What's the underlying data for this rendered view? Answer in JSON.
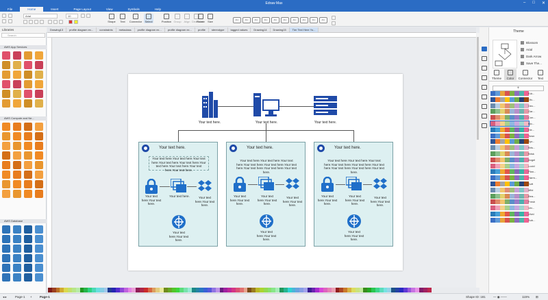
{
  "window": {
    "title": "Edraw Max"
  },
  "menu": [
    "File",
    "Home",
    "Insert",
    "Page Layout",
    "View",
    "Symbols",
    "Help"
  ],
  "ribbon": {
    "font": "Arial",
    "size": "10",
    "tools": [
      "Shape",
      "Text",
      "Connector",
      "Select",
      "Position",
      "Group",
      "Align",
      "Distribute",
      "Rotate",
      "Size"
    ],
    "style_label": "Abc"
  },
  "libraries": {
    "title": "Libraries",
    "search_placeholder": "Search",
    "sections": [
      "AWS App Services",
      "AWS Compute and Ne...",
      "AWS Database"
    ]
  },
  "tabs": [
    "Drawing13",
    "profile diagram ex...",
    "constraints",
    "metaclass",
    "profile diagram ex...",
    "profile diagram ex...",
    "profile",
    "stereotype",
    "tagged values",
    "Drawing14",
    "Drawing15",
    "Tier Text Here Yo..."
  ],
  "diagram": {
    "top_labels": [
      "Your text here.",
      "Your text here.",
      "Your text here."
    ],
    "container_title": "Your text here.",
    "container_body": "Your text here.Your text here.Your text here.Your text here.Your text here.Your text here.Your text here.Your text here.Your text here.",
    "icon_captions_a": "Your text here.Your text here.",
    "icon_caption_b": "Your text here.",
    "icon_caption_c": "Your text here.Your text here."
  },
  "theme_panel": {
    "title": "Theme",
    "options": [
      "Blossom",
      "Arial",
      "Dark Arrow",
      "Save The..."
    ],
    "tabs": [
      "Theme",
      "Color",
      "Connector",
      "Text"
    ],
    "palettes": [
      "Edr...",
      "Ofc...",
      "Dec...",
      "Gar...",
      "Con...",
      "Blo...",
      "Ele...",
      "Town",
      "Spr...",
      "Bris...",
      "Brisk",
      "Angel",
      "Lucid",
      "Plan...",
      "Harm...",
      "Soft",
      "Mild",
      "Bea...",
      "Fresh",
      "Ver...",
      "Vivid",
      "Sub..."
    ]
  },
  "status": {
    "page_label": "Page-1",
    "active_page": "Page-1",
    "shape_id": "Shape ID: 181",
    "zoom": "115%"
  },
  "colors": {
    "accent": "#2b6cc4",
    "container": "#ddf0f1",
    "icon_blue": "#1f4aa8"
  }
}
